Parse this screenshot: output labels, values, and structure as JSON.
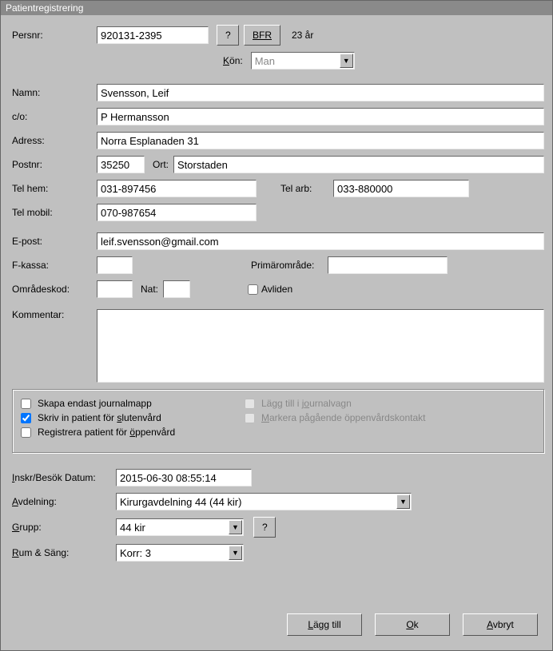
{
  "window": {
    "title": "Patientregistrering"
  },
  "form": {
    "persnr": {
      "label": "Persnr:",
      "value": "920131-2395"
    },
    "help": "?",
    "bfr": "BFR",
    "age": "23 år",
    "gender": {
      "label": "Kön:",
      "value": "Man"
    },
    "name": {
      "label": "Namn:",
      "value": "Svensson, Leif"
    },
    "co": {
      "label": "c/o:",
      "value": "P Hermansson"
    },
    "address": {
      "label": "Adress:",
      "value": "Norra Esplanaden 31"
    },
    "postnr": {
      "label": "Postnr:",
      "value": "35250"
    },
    "ort": {
      "label": "Ort:",
      "value": "Storstaden"
    },
    "telhem": {
      "label": "Tel hem:",
      "value": "031-897456"
    },
    "telarb": {
      "label": "Tel arb:",
      "value": "033-880000"
    },
    "telmobil": {
      "label": "Tel mobil:",
      "value": "070-987654"
    },
    "email": {
      "label": "E-post:",
      "value": "leif.svensson@gmail.com"
    },
    "fkassa": {
      "label": "F-kassa:",
      "value": ""
    },
    "primar": {
      "label": "Primärområde:",
      "value": ""
    },
    "omrade": {
      "label": "Områdeskod:",
      "value": ""
    },
    "nat": {
      "label": "Nat:",
      "value": ""
    },
    "avliden": {
      "label": "Avliden"
    },
    "comment": {
      "label": "Kommentar:",
      "value": ""
    }
  },
  "options": {
    "skapa": {
      "pre": "Skapa endast ",
      "u": "j",
      "post": "ournalmapp",
      "checked": false
    },
    "sluten": {
      "pre": "Skriv in patient för ",
      "u": "s",
      "post": "lutenvård",
      "checked": true
    },
    "oppen": {
      "pre": "Registrera patient för ",
      "u": "ö",
      "post": "ppenvård",
      "checked": false
    },
    "lagg": {
      "pre": "Lägg till i j",
      "u": "o",
      "post": "urnalvagn",
      "checked": false
    },
    "markera": {
      "pre": "",
      "u": "M",
      "post": "arkera pågående öppenvårdskontakt",
      "checked": false
    }
  },
  "admit": {
    "datum": {
      "label_u": "I",
      "label_post": "nskr/Besök Datum:",
      "value": "2015-06-30 08:55:14"
    },
    "avdelning": {
      "label_u": "A",
      "label_post": "vdelning:",
      "value": "Kirurgavdelning 44 (44 kir)"
    },
    "grupp": {
      "label_u": "G",
      "label_post": "rupp:",
      "value": "44 kir",
      "help": "?"
    },
    "rum": {
      "label_u": "R",
      "label_post": "um & Säng:",
      "value": "Korr: 3"
    }
  },
  "footer": {
    "add": {
      "u": "L",
      "post": "ägg till"
    },
    "ok": {
      "u": "O",
      "post": "k"
    },
    "cancel": {
      "u": "A",
      "post": "vbryt"
    }
  }
}
